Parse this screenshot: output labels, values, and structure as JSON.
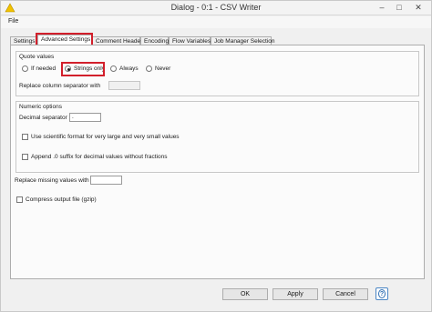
{
  "window": {
    "title": "Dialog - 0:1 - CSV Writer"
  },
  "menu": {
    "file": "File"
  },
  "tabs": [
    {
      "label": "Settings"
    },
    {
      "label": "Advanced Settings"
    },
    {
      "label": "Comment Header"
    },
    {
      "label": "Encoding"
    },
    {
      "label": "Flow Variables"
    },
    {
      "label": "Job Manager Selection"
    }
  ],
  "quote_values": {
    "title": "Quote values",
    "options": [
      "If needed",
      "Strings only",
      "Always",
      "Never"
    ],
    "selected": "Strings only",
    "replace_sep_label": "Replace column separator with",
    "replace_sep_value": ""
  },
  "numeric_options": {
    "title": "Numeric options",
    "decimal_label": "Decimal separator",
    "decimal_value": ".",
    "scientific_label": "Use scientific format for very large and very small values",
    "append_label": "Append .0 suffix for decimal values without fractions"
  },
  "missing": {
    "label": "Replace missing values with",
    "value": ""
  },
  "compress": {
    "label": "Compress output file (gzip)"
  },
  "buttons": {
    "ok": "OK",
    "apply": "Apply",
    "cancel": "Cancel"
  },
  "colors": {
    "highlight": "#d21f2b",
    "help_blue": "#2f6fb3"
  }
}
